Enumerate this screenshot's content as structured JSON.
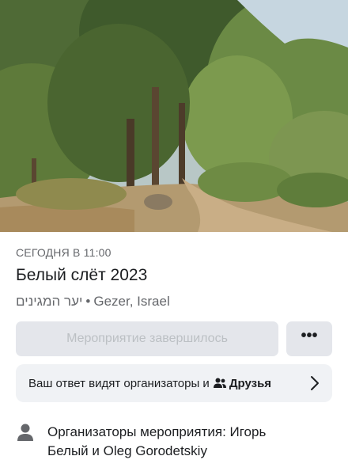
{
  "event": {
    "date": "СЕГОДНЯ В 11:00",
    "title": "Белый слёт 2023",
    "location_hebrew": "יער המגינים",
    "location_separator": "•",
    "location_city": "Gezer, Israel",
    "status_label": "Мероприятие завершилось",
    "more_label": "•••"
  },
  "visibility": {
    "text": "Ваш ответ видят организаторы и",
    "friends_label": "Друзья"
  },
  "organizers": {
    "line1": "Организаторы мероприятия: Игорь",
    "line2": "Белый и Oleg Gorodetskiy"
  },
  "icons": {
    "more": "more-dots-icon",
    "friends": "friends-icon",
    "chevron": "chevron-right-icon",
    "person": "person-icon"
  },
  "colors": {
    "secondary_text": "#65676b",
    "button_bg": "#e4e6eb",
    "disabled_text": "#bcc0c4",
    "row_bg": "#f0f2f5"
  }
}
